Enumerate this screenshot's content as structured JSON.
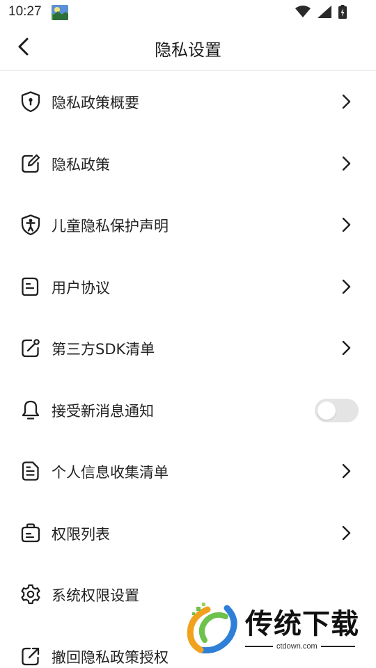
{
  "status_bar": {
    "time": "10:27",
    "icons": [
      "wifi-icon",
      "signal-icon",
      "battery-charging-icon"
    ]
  },
  "header": {
    "back_icon": "chevron-left-icon",
    "title": "隐私设置"
  },
  "menu": [
    {
      "label": "隐私政策概要",
      "icon": "shield-lock-icon",
      "control": "chevron"
    },
    {
      "label": "隐私政策",
      "icon": "edit-document-icon",
      "control": "chevron"
    },
    {
      "label": "儿童隐私保护声明",
      "icon": "child-shield-icon",
      "control": "chevron"
    },
    {
      "label": "用户协议",
      "icon": "agreement-doc-icon",
      "control": "chevron"
    },
    {
      "label": "第三方SDK清单",
      "icon": "sdk-link-icon",
      "control": "chevron"
    },
    {
      "label": "接受新消息通知",
      "icon": "bell-icon",
      "control": "toggle",
      "enabled": false
    },
    {
      "label": "个人信息收集清单",
      "icon": "document-list-icon",
      "control": "chevron"
    },
    {
      "label": "权限列表",
      "icon": "permission-bag-icon",
      "control": "chevron"
    },
    {
      "label": "系统权限设置",
      "icon": "gear-icon",
      "control": "none"
    },
    {
      "label": "撤回隐私政策授权",
      "icon": "revoke-share-icon",
      "control": "none"
    }
  ],
  "watermark": {
    "brand": "传统下载",
    "url": "ctdown.com"
  },
  "colors": {
    "background": "#ffffff",
    "text": "#222222",
    "toggle_off": "#e4e4e4",
    "divider": "#ececec"
  }
}
